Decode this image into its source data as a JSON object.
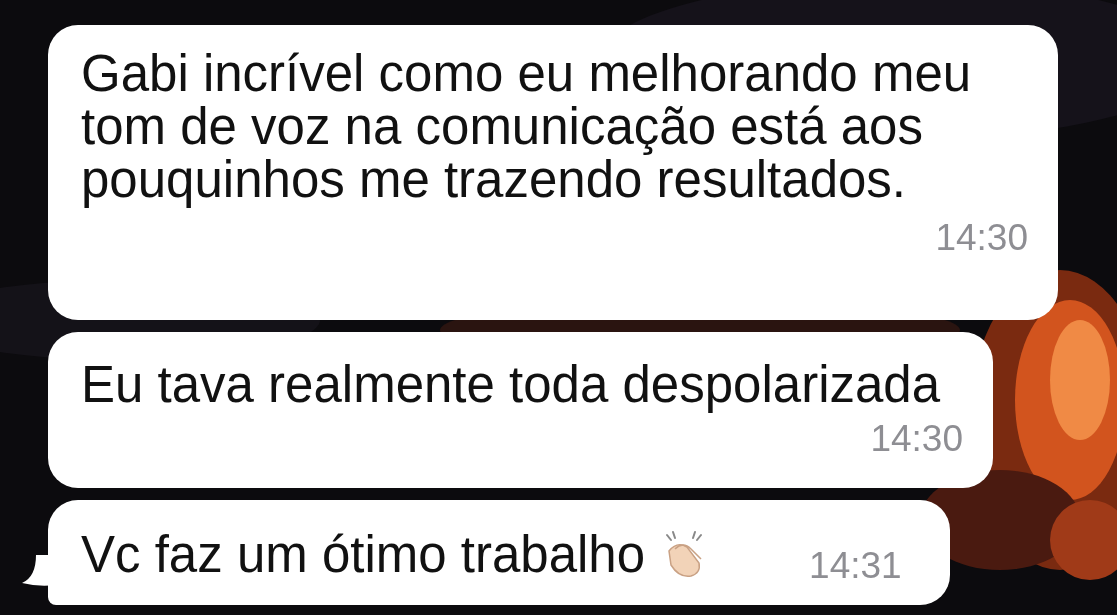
{
  "messages": [
    {
      "text": "Gabi incrível como eu melhorando meu tom de voz na comunicação está aos pouquinhos me trazendo resultados.",
      "time": "14:30",
      "kind": "plain",
      "tail": false
    },
    {
      "text": "Eu tava realmente toda despolarizada",
      "time": "14:30",
      "kind": "plain",
      "tail": false
    },
    {
      "text": "Vc faz um ótimo trabalho",
      "time": "14:31",
      "kind": "emoji",
      "tail": true
    }
  ]
}
